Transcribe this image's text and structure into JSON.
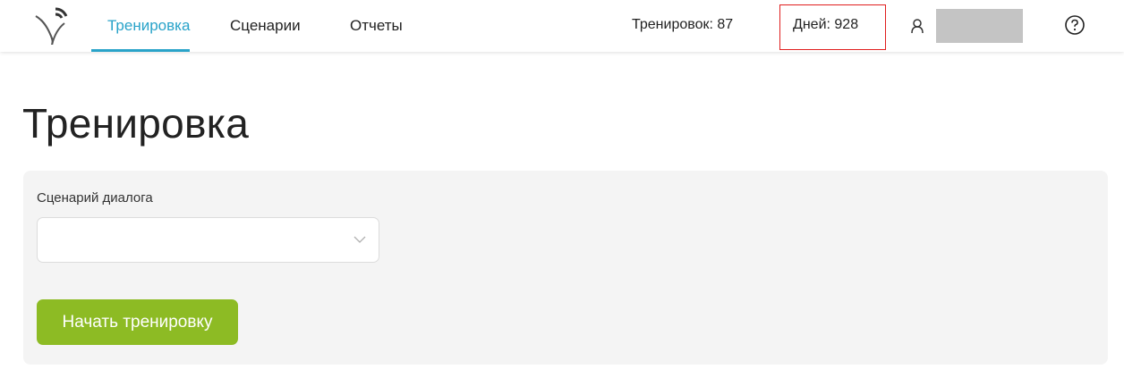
{
  "nav": {
    "items": [
      {
        "label": "Тренировка",
        "active": true
      },
      {
        "label": "Сценарии",
        "active": false
      },
      {
        "label": "Отчеты",
        "active": false
      }
    ]
  },
  "stats": {
    "trainings": "Тренировок: 87",
    "days": "Дней: 928"
  },
  "page": {
    "title": "Тренировка"
  },
  "form": {
    "scenario_label": "Сценарий диалога",
    "scenario_value": "",
    "start_button": "Начать тренировку"
  },
  "colors": {
    "accent": "#29a3c9",
    "button": "#8dbb24",
    "highlight_border": "#e01e1e",
    "panel": "#f4f4f4"
  },
  "icons": [
    "logo-icon",
    "user-icon",
    "help-icon",
    "chevron-down-icon"
  ]
}
